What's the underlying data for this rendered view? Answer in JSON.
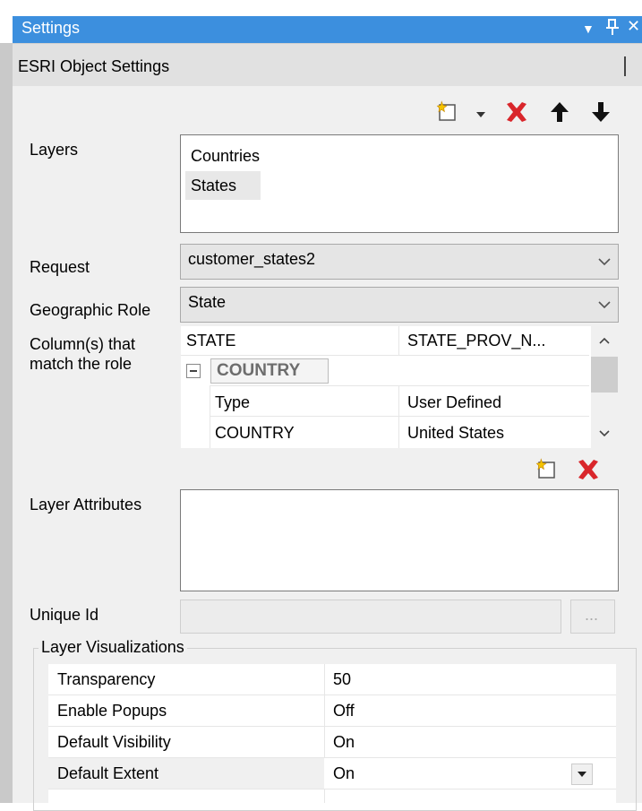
{
  "window": {
    "title": "Settings",
    "dropdown_glyph": "▼",
    "pin_glyph": "📌",
    "close_glyph": "✕"
  },
  "section_header": {
    "title": "ESRI Object Settings"
  },
  "toolbar_top": {
    "icons": [
      "new-item-icon",
      "dropdown-arrow-icon",
      "delete-icon",
      "move-up-icon",
      "move-down-icon"
    ]
  },
  "layers": {
    "label": "Layers",
    "items": [
      "Countries",
      "States"
    ],
    "selected_index": 1
  },
  "request": {
    "label": "Request",
    "value": "customer_states2"
  },
  "geographic_role": {
    "label": "Geographic Role",
    "value": "State"
  },
  "columns_match": {
    "label_line1": "Column(s) that",
    "label_line2": "match the role",
    "header_left": "STATE",
    "header_right": "STATE_PROV_N...",
    "group_label": "COUNTRY",
    "rows": [
      {
        "name": "Type",
        "value": "User Defined"
      },
      {
        "name": "COUNTRY",
        "value": "United States"
      }
    ]
  },
  "toolbar_mid": {
    "icons": [
      "new-item-icon",
      "delete-icon"
    ]
  },
  "layer_attributes": {
    "label": "Layer Attributes"
  },
  "unique_id": {
    "label": "Unique Id",
    "value": "",
    "browse_label": "..."
  },
  "layer_visualizations": {
    "title": "Layer Visualizations",
    "rows": [
      {
        "name": "Transparency",
        "value": "50"
      },
      {
        "name": "Enable Popups",
        "value": "Off"
      },
      {
        "name": "Default Visibility",
        "value": "On"
      },
      {
        "name": "Default Extent",
        "value": "On"
      }
    ]
  },
  "colors": {
    "titlebar": "#3c8fde",
    "delete_red": "#d9262b",
    "selection": "#e8e8e8"
  }
}
